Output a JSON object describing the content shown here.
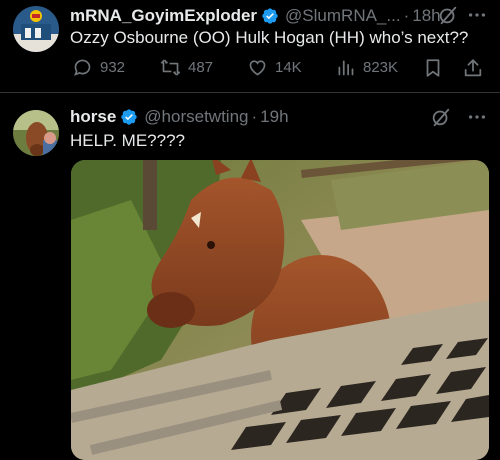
{
  "tweets": [
    {
      "display_name": "mRNA_GoyimExploder",
      "handle": "@SlumRNA_...",
      "separator": "·",
      "time": "18h",
      "text": "Ozzy Osbourne (OO) Hulk Hogan (HH) who’s next??",
      "stats": {
        "replies": "932",
        "retweets": "487",
        "likes": "14K",
        "views": "823K"
      }
    },
    {
      "display_name": "horse",
      "handle": "@horsetwting",
      "separator": "·",
      "time": "19h",
      "text": "HELP. ME????"
    }
  ],
  "colors": {
    "background": "#000000",
    "text": "#e7e9ea",
    "muted": "#71767b",
    "verified": "#1d9bf0",
    "divider": "#2f3336"
  },
  "icons": [
    "verified-badge-icon",
    "grok-icon",
    "more-icon",
    "reply-icon",
    "retweet-icon",
    "like-icon",
    "views-icon",
    "bookmark-icon",
    "share-icon"
  ]
}
